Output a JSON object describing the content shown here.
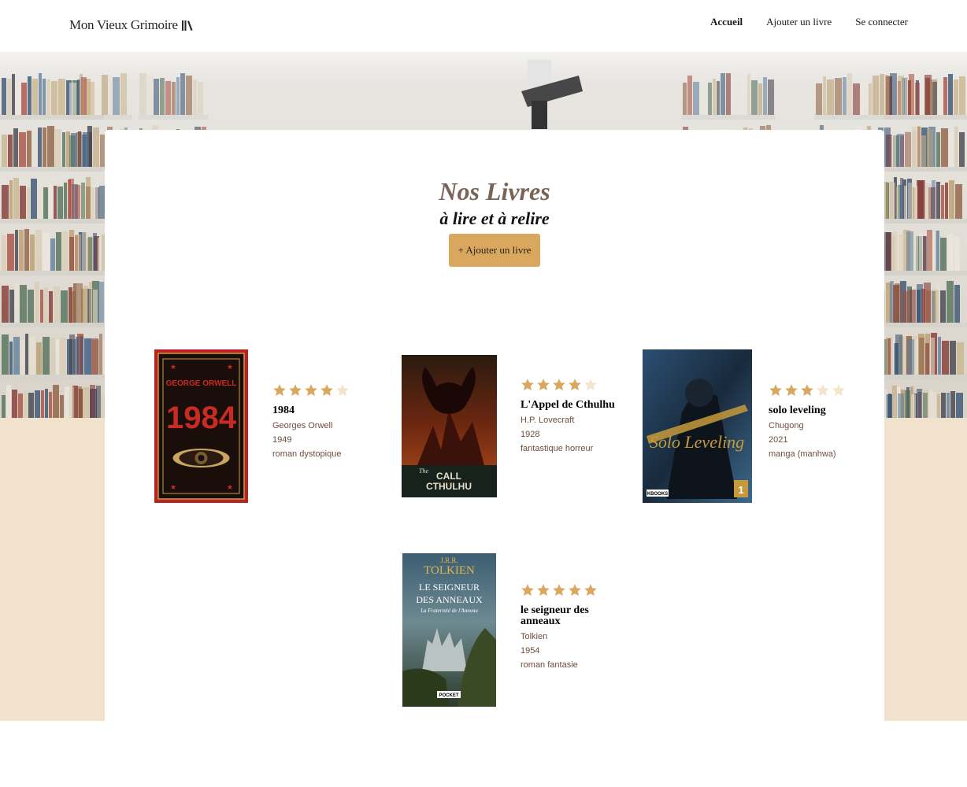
{
  "brand": {
    "name": "Mon Vieux Grimoire"
  },
  "nav": {
    "home": "Accueil",
    "add_book": "Ajouter un livre",
    "login": "Se connecter"
  },
  "page": {
    "title": "Nos Livres",
    "subtitle": "à lire et à relire",
    "add_button": "+ Ajouter un livre"
  },
  "colors": {
    "accent": "#d9a75d",
    "star_filled": "#d9a75d",
    "star_empty": "#f3e4cd",
    "beige_band": "#f0e2cc",
    "meta_text": "#6e4e3e"
  },
  "books": [
    {
      "title": "1984",
      "author": "Georges Orwell",
      "year": "1949",
      "genre": "roman dystopique",
      "rating": 4,
      "cover": {
        "top": "GEORGE ORWELL",
        "main": "1984"
      }
    },
    {
      "title": "L'Appel de Cthulhu",
      "author": "H.P. Lovecraft",
      "year": "1928",
      "genre": "fantastique horreur",
      "rating": 4,
      "cover": {
        "top": "The",
        "main": "CALL",
        "sub": "CTHULHU"
      }
    },
    {
      "title": "solo leveling",
      "author": "Chugong",
      "year": "2021",
      "genre": "manga (manhwa)",
      "rating": 3,
      "cover": {
        "main": "Solo Leveling",
        "volume": "1",
        "publisher": "KBOOKS"
      }
    },
    {
      "title": "le seigneur des anneaux",
      "author": "Tolkien",
      "year": "1954",
      "genre": "roman fantasie",
      "rating": 5,
      "cover": {
        "author": "J.R.R. TOLKIEN",
        "main": "LE SEIGNEUR DES ANNEAUX",
        "sub": "La Fraternité de l'Anneau",
        "publisher": "POCKET"
      }
    }
  ]
}
